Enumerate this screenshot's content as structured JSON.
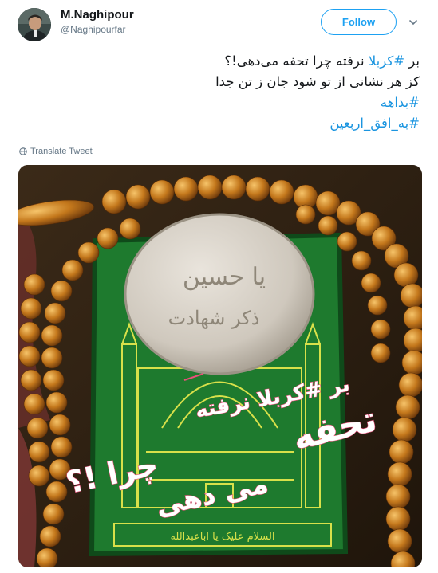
{
  "header": {
    "display_name": "M.Naghipour",
    "handle": "@Naghipourfar",
    "follow_label": "Follow"
  },
  "tweet": {
    "line1_prefix": "بر ",
    "line1_hashtag": "#کربلا",
    "line1_rest": " نرفته چرا تحفه می‌دهی!؟",
    "line2": "کز هر نشانی از تو شود جان ز تن جدا",
    "hashtag1": "#بداهه",
    "hashtag2": "#به_افق_اربعین"
  },
  "translate": {
    "label": "Translate Tweet"
  },
  "photo": {
    "overlay_line1": "بر #کربلا نرفته",
    "overlay_line2": "تحفه",
    "overlay_line3": "می دهی",
    "overlay_line4": "چرا !؟",
    "seal_line1": "یا حسین",
    "seal_line2": "ذکر شهادت",
    "cloth_text": "السلام علیک یا اباعبدالله",
    "accent_colors": {
      "cloth_green": "#1e7a2e",
      "thread_yellow": "#d8e04a",
      "bead_amber": "#c4781c",
      "seal_clay": "#cfc8bd"
    }
  },
  "colors": {
    "brand_blue": "#1da1f2",
    "hashtag_blue": "#1b95e0",
    "secondary_text": "#657786"
  }
}
